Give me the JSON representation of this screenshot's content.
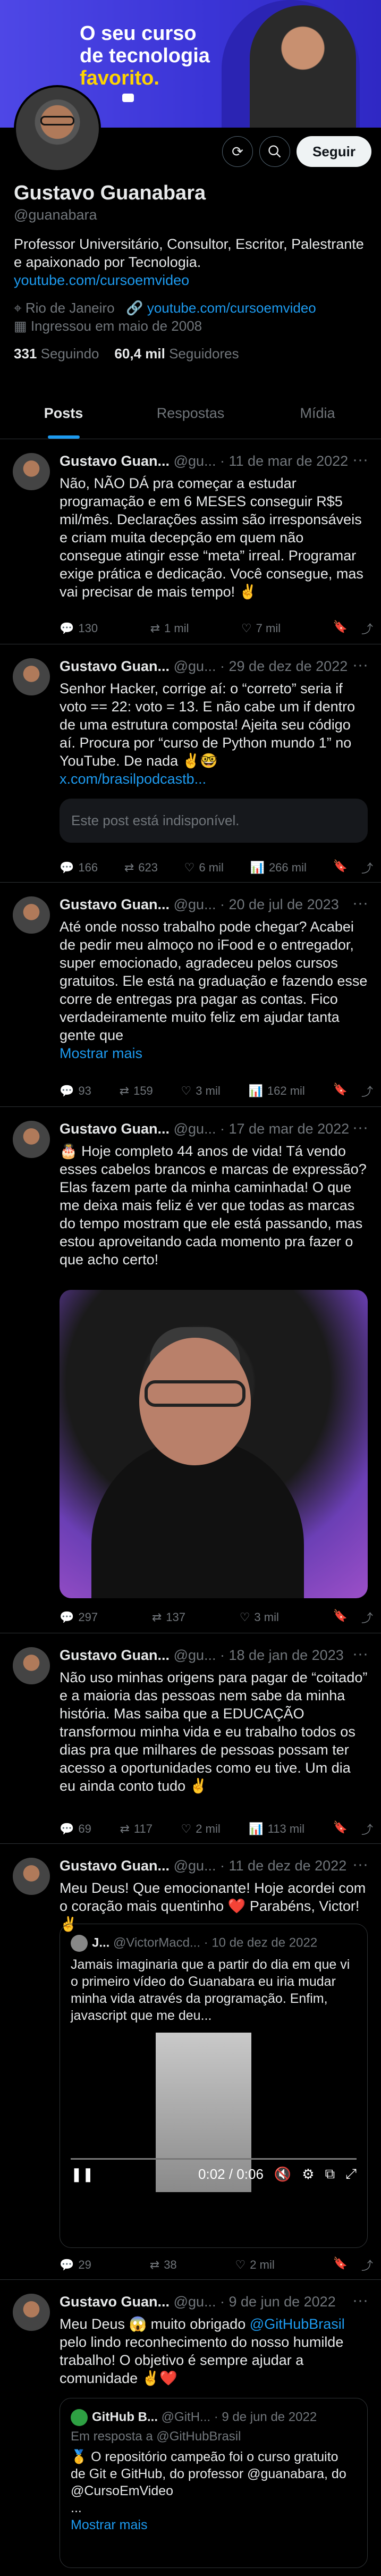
{
  "banner": {
    "line1": "O seu curso",
    "line2": "de tecnologia",
    "line3": "favorito."
  },
  "profile": {
    "name": "Gustavo Guanabara",
    "handle": "@guanabara",
    "bio": "Professor Universitário, Consultor, Escritor, Palestrante e apaixonado por Tecnologia.",
    "bio_link": "youtube.com/cursoemvideo",
    "location": "Rio de Janeiro",
    "website": "youtube.com/cursoemvideo",
    "joined": "Ingressou em maio de 2008",
    "following_count": "331",
    "following_label": "Seguindo",
    "followers_count": "60,4 mil",
    "followers_label": "Seguidores",
    "follow_button": "Seguir"
  },
  "tabs": [
    "Posts",
    "Respostas",
    "Mídia"
  ],
  "tweets": [
    {
      "name": "Gustavo Guan...",
      "handle": "@gu...",
      "date": "· 11 de mar de 2022",
      "text": "Não, NÃO DÁ pra começar a estudar programação e em 6 MESES conseguir R$5 mil/mês. Declarações assim são irresponsáveis e criam muita decepção em quem não consegue atingir esse “meta” irreal. Programar exige prática e dedicação. Você consegue, mas vai precisar de mais tempo! ✌",
      "replies": "130",
      "retweets": "1 mil",
      "likes": "7 mil",
      "views": ""
    },
    {
      "name": "Gustavo Guan...",
      "handle": "@gu...",
      "date": "· 29 de dez de 2022",
      "text": "Senhor Hacker, corrige aí: o “correto” seria if voto == 22: voto = 13. E não cabe um if dentro de uma estrutura composta! Ajeita seu código aí. Procura por “curso de Python mundo 1” no YouTube. De nada ✌🤓",
      "link": "x.com/brasilpodcastb...",
      "embed": "Este post está indisponível.",
      "replies": "166",
      "retweets": "623",
      "likes": "6 mil",
      "views": "266 mil"
    },
    {
      "name": "Gustavo Guan...",
      "handle": "@gu...",
      "date": "· 20 de jul de 2023",
      "text": "Até onde nosso trabalho pode chegar? Acabei de pedir meu almoço no iFood e o entregador, super emocionado, agradeceu pelos cursos gratuitos. Ele está na graduação e fazendo esse corre de entregas pra pagar as contas. Fico verdadeiramente muito feliz em ajudar tanta gente que",
      "more": "Mostrar mais",
      "replies": "93",
      "retweets": "159",
      "likes": "3 mil",
      "views": "162 mil"
    },
    {
      "name": "Gustavo Guan...",
      "handle": "@gu...",
      "date": "· 17 de mar de 2022",
      "text": "🎂 Hoje completo 44 anos de vida! Tá vendo esses cabelos brancos e marcas de expressão? Elas fazem parte da minha caminhada! O que me deixa mais feliz é ver que todas as marcas do tempo mostram que ele está passando, mas estou aproveitando cada momento pra fazer o que acho certo!",
      "replies": "297",
      "retweets": "137",
      "likes": "3 mil",
      "views": ""
    },
    {
      "name": "Gustavo Guan...",
      "handle": "@gu...",
      "date": "· 18 de jan de 2023",
      "text": "Não uso minhas origens para pagar de “coitado” e a maioria das pessoas nem sabe da minha história. Mas saiba que a EDUCAÇÃO transformou minha vida e eu trabalho todos os dias pra que milhares de pessoas possam ter acesso a oportunidades como eu tive. Um dia eu ainda conto tudo ✌",
      "replies": "69",
      "retweets": "117",
      "likes": "2 mil",
      "views": "113 mil"
    },
    {
      "name": "Gustavo Guan...",
      "handle": "@gu...",
      "date": "· 11 de dez de 2022",
      "text": "Meu Deus! Que emocionante! Hoje acordei com o coração mais quentinho ❤️ Parabéns, Victor! ✌",
      "quote": {
        "name": "J...",
        "handle": "@VictorMacd...",
        "date": "· 10 de dez de 2022",
        "text": "Jamais imaginaria que a partir do dia em que vi o primeiro vídeo do Guanabara eu iria mudar minha vida através da programação. Enfim, javascript que me deu...",
        "time": "0:02 / 0:06"
      },
      "replies": "29",
      "retweets": "38",
      "likes": "2 mil",
      "views": ""
    },
    {
      "name": "Gustavo Guan...",
      "handle": "@gu...",
      "date": "· 9 de jun de 2022",
      "text_pre": "Meu Deus 😱 muito obrigado ",
      "mention": "@GitHubBrasil",
      "text_post": " pelo lindo reconhecimento do nosso humilde trabalho! O objetivo é sempre ajudar a comunidade ✌❤️",
      "quote": {
        "name": "GitHub B...",
        "handle": "@GitH...",
        "date": "· 9 de jun de 2022",
        "replying": "Em resposta a @GitHubBrasil",
        "text": "🥇 O repositório campeão foi o curso gratuito de Git e GitHub, do professor @guanabara, do @CursoEmVideo",
        "ellipsis": "...",
        "more": "Mostrar mais"
      }
    }
  ]
}
